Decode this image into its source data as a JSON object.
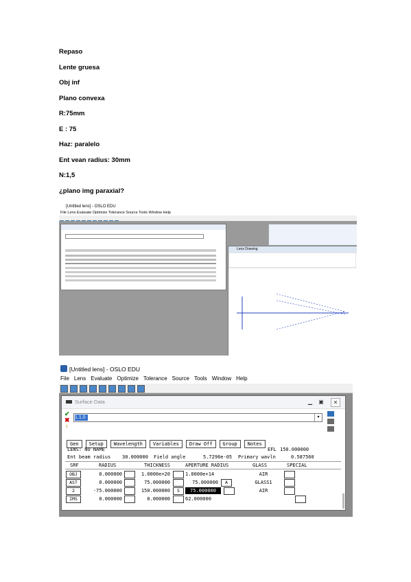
{
  "notes": [
    "Repaso",
    "Lente gruesa",
    "Obj inf",
    "Plano convexa",
    "R:75mm",
    "E : 75",
    "Haz: paralelo",
    "Ent vean radius: 30mm",
    "N:1,5",
    "¿plano img paraxial?"
  ],
  "window": {
    "title": "[Untitled lens] - OSLO EDU",
    "menu": [
      "File",
      "Lens",
      "Evaluate",
      "Optimize",
      "Tolerance",
      "Source",
      "Tools",
      "Window",
      "Help"
    ]
  },
  "surface_data": {
    "title": "Surface Data",
    "edit_value": "1.1.0",
    "buttons": [
      "Gen",
      "Setup",
      "Wavelength",
      "Variables",
      "Draw Off",
      "Group",
      "Notes"
    ],
    "lens_name": "LENS: NO NAME",
    "eff_label": "EFL",
    "eff_value": "150.000000",
    "ent_beam_label": "Ent beam radius",
    "ent_beam_value": "30.000000",
    "field_angle_label": "Field angle",
    "field_angle_value": "5.7296e-05",
    "primary_wavln_label": "Primary wavln",
    "primary_wavln_value": "0.587560",
    "columns": [
      "SRF",
      "RADIUS",
      "THICKNESS",
      "APERTURE RADIUS",
      "GLASS",
      "SPECIAL"
    ],
    "rows": [
      {
        "srf": "OBJ",
        "radius": "0.000000",
        "thickness": "1.0000e+20",
        "aperture": "1.0000e+14",
        "glass": "AIR",
        "tflag": "",
        "aflag": ""
      },
      {
        "srf": "AST",
        "radius": "0.000000",
        "thickness": "75.000000",
        "aperture": "75.000000",
        "glass": "GLASS1",
        "tflag": "",
        "aflag": "A"
      },
      {
        "srf": "2",
        "radius": "-75.000000",
        "thickness": "150.000000",
        "aperture": "75.000000",
        "glass": "AIR",
        "tflag": "S",
        "aflag": ""
      },
      {
        "srf": "IMS",
        "radius": "0.000000",
        "thickness": "0.000000",
        "aperture": "62.000000",
        "glass": "",
        "tflag": "",
        "aflag": ""
      }
    ]
  },
  "small_shot": {
    "title": "[Untitled lens] - OSLO EDU",
    "menu": "File  Lens  Evaluate  Optimize  Tolerance  Source  Tools  Window  Help",
    "lens_drawing_title": "Lens Drawing"
  },
  "colors": {
    "selection": "#3370cc",
    "ray": "#1f3fbf",
    "desktop": "#8c8c8c"
  }
}
